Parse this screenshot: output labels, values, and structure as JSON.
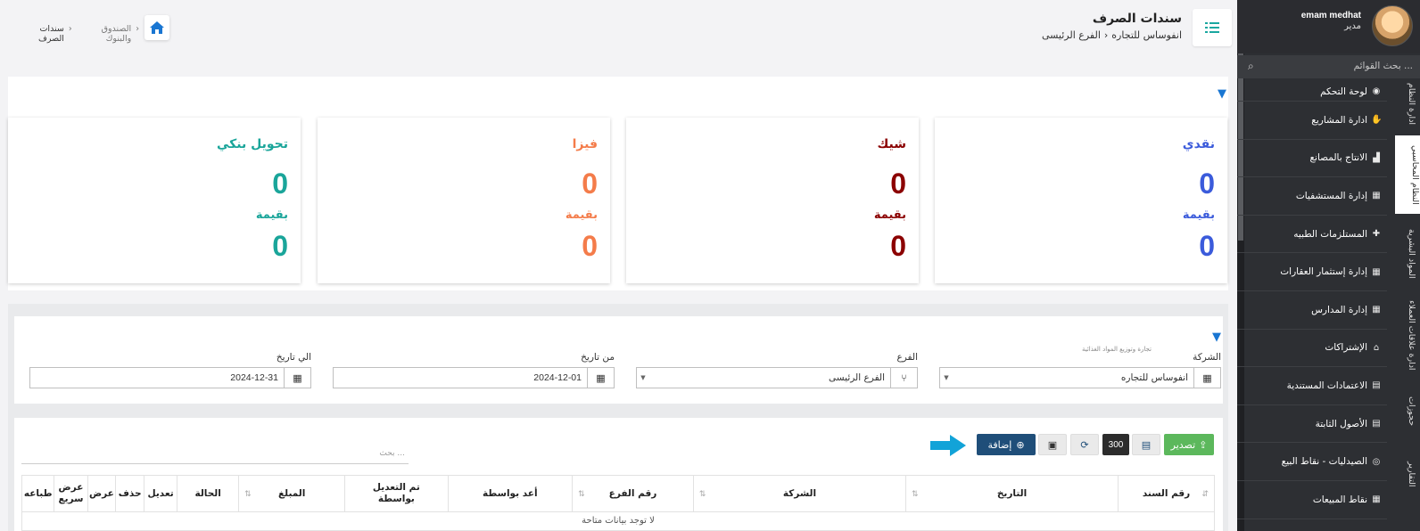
{
  "header": {
    "title": "سندات الصرف",
    "breadcrumb": [
      "انفوساس للتجاره",
      "الفرع الرئيسى"
    ],
    "path": [
      "الصندوق والبنوك",
      "سندات الصرف"
    ]
  },
  "sidebar": {
    "user_name": "emam medhat",
    "user_role": "مدير",
    "search_placeholder": "بحث القوائم ...",
    "items": [
      {
        "label": "لوحة التحكم",
        "icon": "dashboard-icon",
        "glyph": "◉"
      },
      {
        "label": "ادارة المشاريع",
        "icon": "handshake-icon",
        "glyph": "✋"
      },
      {
        "label": "الانتاج بالمصانع",
        "icon": "factory-icon",
        "glyph": "▟"
      },
      {
        "label": "إدارة المستشفيات",
        "icon": "hospital-icon",
        "glyph": "▦"
      },
      {
        "label": "المستلزمات الطبيه",
        "icon": "medkit-icon",
        "glyph": "✚"
      },
      {
        "label": "إدارة إستثمار العقارات",
        "icon": "building-icon",
        "glyph": "▦"
      },
      {
        "label": "إدارة المدارس",
        "icon": "school-icon",
        "glyph": "▦"
      },
      {
        "label": "الإشتراكات",
        "icon": "bank-icon",
        "glyph": "⌂"
      },
      {
        "label": "الاعتمادات المستندية",
        "icon": "document-icon",
        "glyph": "▤"
      },
      {
        "label": "الأصول الثابتة",
        "icon": "file-icon",
        "glyph": "▤"
      },
      {
        "label": "الصيدليات - نقاط البيع",
        "icon": "binoculars-icon",
        "glyph": "◎"
      },
      {
        "label": "نقاط المبيعات",
        "icon": "store-icon",
        "glyph": "▦"
      }
    ],
    "tabs": [
      "ادارة النظام",
      "النظام المحاسبي",
      "المواد البشرية",
      "ادارة علاقات العملاء",
      "حجوزات",
      "التقارير"
    ]
  },
  "stats": {
    "value_label": "بقيمة",
    "cards": [
      {
        "title": "نقدي",
        "count": "0",
        "value": "0",
        "color": "#3b5bdb"
      },
      {
        "title": "شيك",
        "count": "0",
        "value": "0",
        "color": "#8b0000"
      },
      {
        "title": "فيزا",
        "count": "0",
        "value": "0",
        "color": "#f47c4a"
      },
      {
        "title": "تحويل بنكي",
        "count": "0",
        "value": "0",
        "color": "#1aa59a"
      }
    ]
  },
  "filters": {
    "company_label": "الشركة",
    "company_sub": "تجارة وتوزيع المواد الغذائية",
    "company_value": "انفوساس للتجاره",
    "branch_label": "الفرع",
    "branch_value": "الفرع الرئيسى",
    "from_label": "من تاريخ",
    "from_value": "2024-12-01",
    "to_label": "الي تاريخ",
    "to_value": "2024-12-31"
  },
  "toolbar": {
    "export_label": "تصدير",
    "page_size": "300",
    "add_label": "إضافة",
    "search_placeholder": "بحث ..."
  },
  "table": {
    "columns": [
      "رقم السند",
      "التاريخ",
      "الشركة",
      "رقم الفرع",
      "أعد بواسطة",
      "تم التعديل بواسطة",
      "المبلغ",
      "الحالة",
      "تعديل",
      "حذف",
      "عرض",
      "عرض سريع",
      "طباعه"
    ],
    "empty_text": "لا توجد بيانات متاحة"
  },
  "colors": {
    "accent_teal": "#1aa7a0",
    "export_green": "#5cb85c",
    "add_navy": "#1f4e79",
    "arrow_cyan": "#12a3d8"
  }
}
